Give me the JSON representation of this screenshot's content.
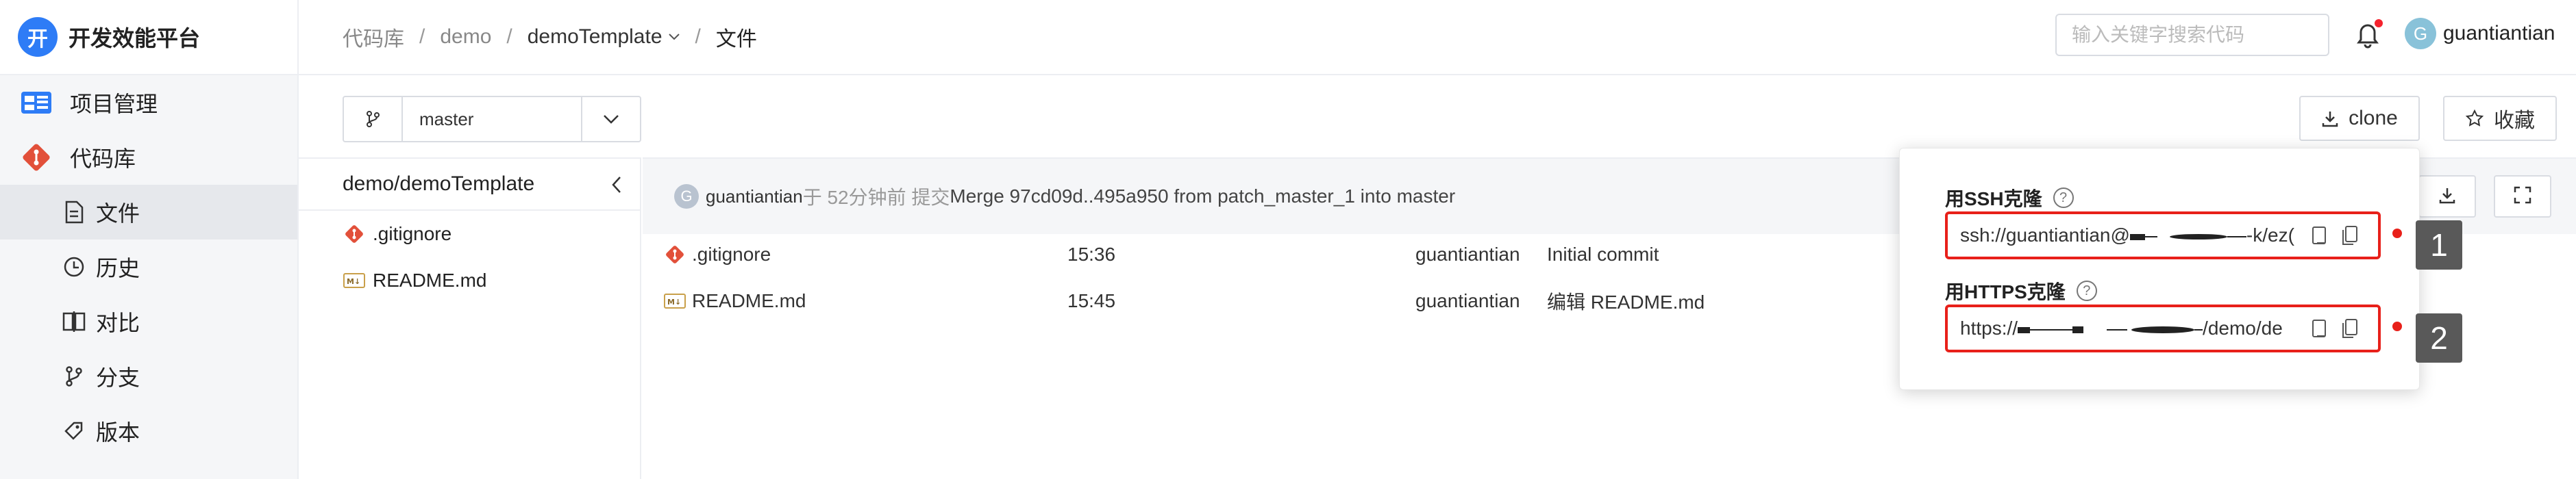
{
  "app": {
    "logo_char": "开",
    "title": "开发效能平台"
  },
  "sidebar": {
    "items": [
      {
        "label": "项目管理",
        "icon": "dashboard-icon"
      },
      {
        "label": "代码库",
        "icon": "git-icon"
      }
    ],
    "subitems": [
      {
        "label": "文件",
        "icon": "file-icon",
        "active": true
      },
      {
        "label": "历史",
        "icon": "clock-icon"
      },
      {
        "label": "对比",
        "icon": "compare-icon"
      },
      {
        "label": "分支",
        "icon": "branch-icon"
      },
      {
        "label": "版本",
        "icon": "tag-icon"
      }
    ]
  },
  "breadcrumb": {
    "root": "代码库",
    "sep": "/",
    "group": "demo",
    "repo": "demoTemplate",
    "current": "文件"
  },
  "header": {
    "search_placeholder": "输入关键字搜索代码",
    "username": "guantiantian",
    "avatar_char": "G"
  },
  "toolbar": {
    "branch": "master",
    "clone_label": "clone",
    "fav_label": "收藏"
  },
  "tree": {
    "path": "demo/demoTemplate",
    "files": [
      {
        "name": ".gitignore",
        "icon": "git-icon"
      },
      {
        "name": "README.md",
        "icon": "markdown-icon"
      }
    ]
  },
  "commit": {
    "avatar_char": "G",
    "user": "guantiantian",
    "meta": "于 52分钟前 提交",
    "message": "Merge 97cd09d..495a950 from patch_master_1 into master"
  },
  "files": [
    {
      "name": ".gitignore",
      "icon": "git-icon",
      "time": "15:36",
      "author": "guantiantian",
      "message": "Initial commit"
    },
    {
      "name": "README.md",
      "icon": "markdown-icon",
      "time": "15:45",
      "author": "guantiantian",
      "message": "编辑 README.md"
    }
  ],
  "clone_popover": {
    "ssh_title": "用SSH克隆",
    "ssh_url_prefix": "ssh://guantiantian@",
    "ssh_url_suffix": "-k/ez(",
    "https_title": "用HTTPS克隆",
    "https_url_prefix": "https://",
    "https_url_suffix": "/demo/de",
    "help_glyph": "?",
    "markers": [
      "1",
      "2"
    ]
  },
  "colors": {
    "accent": "#2e7cf6",
    "highlight": "#e8201a",
    "git": "#e2503a",
    "marker_bg": "#595959"
  }
}
